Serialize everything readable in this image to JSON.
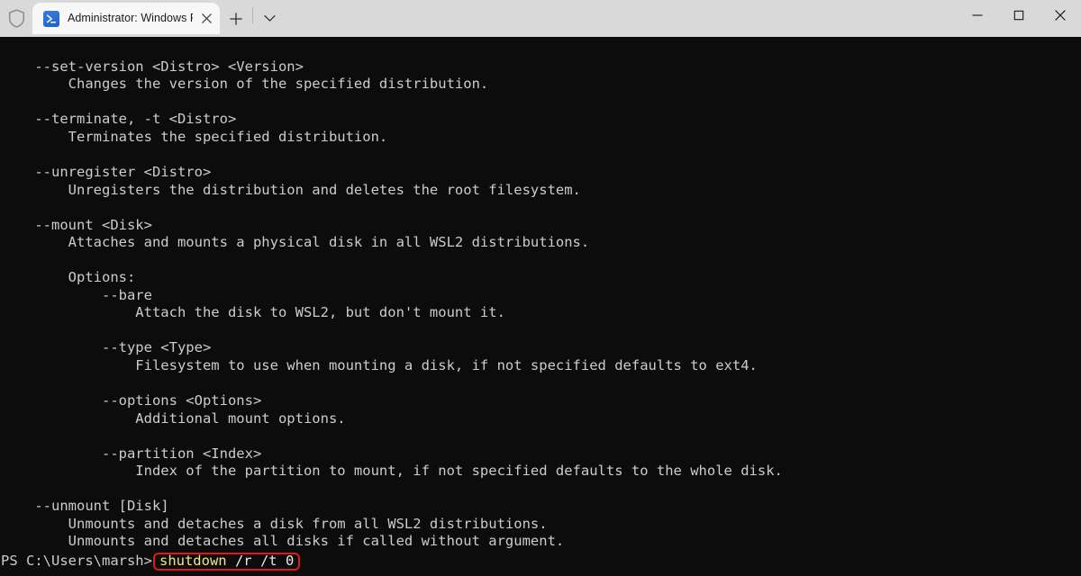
{
  "window": {
    "titlebar": {
      "shield_icon": "shield-icon",
      "tab": {
        "icon": "powershell-icon",
        "title": "Administrator: Windows Powe",
        "close_icon": "close-icon"
      },
      "new_tab_icon": "plus-icon",
      "dropdown_icon": "chevron-down-icon",
      "controls": {
        "minimize": "minimize-icon",
        "maximize": "maximize-icon",
        "close": "close-icon"
      }
    },
    "colors": {
      "titlebar_bg": "#d9d9d9",
      "tab_bg": "#f7f7f7",
      "terminal_bg": "#0c0c0c",
      "terminal_fg": "#cccccc",
      "highlight_border": "#e01b1b",
      "command_keyword": "#f0e68c",
      "powershell_icon": "#2266cc"
    }
  },
  "terminal": {
    "output_lines": [
      "    --set-version <Distro> <Version>",
      "        Changes the version of the specified distribution.",
      "",
      "    --terminate, -t <Distro>",
      "        Terminates the specified distribution.",
      "",
      "    --unregister <Distro>",
      "        Unregisters the distribution and deletes the root filesystem.",
      "",
      "    --mount <Disk>",
      "        Attaches and mounts a physical disk in all WSL2 distributions.",
      "",
      "        Options:",
      "            --bare",
      "                Attach the disk to WSL2, but don't mount it.",
      "",
      "            --type <Type>",
      "                Filesystem to use when mounting a disk, if not specified defaults to ext4.",
      "",
      "            --options <Options>",
      "                Additional mount options.",
      "",
      "            --partition <Index>",
      "                Index of the partition to mount, if not specified defaults to the whole disk.",
      "",
      "    --unmount [Disk]",
      "        Unmounts and detaches a disk from all WSL2 distributions.",
      "        Unmounts and detaches all disks if called without argument."
    ],
    "prompt": {
      "text": "PS C:\\Users\\marsh>",
      "command_keyword": "shutdown",
      "command_args": " /r /t 0"
    }
  }
}
